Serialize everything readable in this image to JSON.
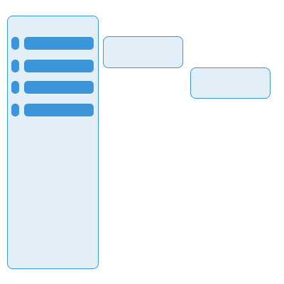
{
  "theme": {
    "accent": "#3a95d9",
    "panel_fill": "#e2eff9",
    "panel_border": "#3a95d9",
    "background": "#ffffff"
  },
  "sidebar": {
    "items": [
      {
        "label": "",
        "icon": "placeholder-pill-icon"
      },
      {
        "label": "",
        "icon": "placeholder-pill-icon"
      },
      {
        "label": "",
        "icon": "placeholder-pill-icon"
      },
      {
        "label": "",
        "icon": "placeholder-pill-icon"
      }
    ]
  },
  "cards": [
    {
      "label": ""
    },
    {
      "label": ""
    }
  ]
}
